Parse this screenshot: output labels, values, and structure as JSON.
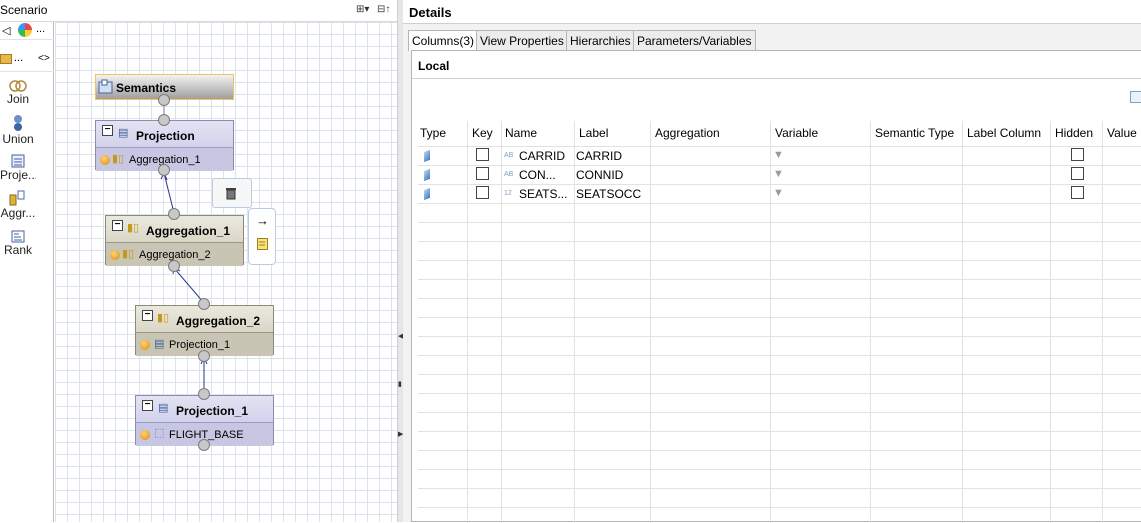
{
  "scenario": {
    "title": "Scenario",
    "toolbar": {
      "expand_label": "⊞▾",
      "collapse_label": "⊟↑"
    },
    "palette_top": {
      "back_label": "◁",
      "more_label": "...",
      "open_label": "...",
      "toggle_label": "<>"
    },
    "palette": [
      {
        "label": "Join",
        "icon": "join-icon"
      },
      {
        "label": "Union",
        "icon": "union-icon"
      },
      {
        "label": "Proje...",
        "icon": "projection-icon"
      },
      {
        "label": "Aggr...",
        "icon": "aggregation-icon"
      },
      {
        "label": "Rank",
        "icon": "rank-icon"
      }
    ]
  },
  "diagram": {
    "semantics": {
      "label": "Semantics"
    },
    "nodes": [
      {
        "title": "Projection",
        "input": "Aggregation_1",
        "kind": "projection"
      },
      {
        "title": "Aggregation_1",
        "input": "Aggregation_2",
        "kind": "aggregation"
      },
      {
        "title": "Aggregation_2",
        "input": "Projection_1",
        "kind": "aggregation"
      },
      {
        "title": "Projection_1",
        "input": "FLIGHT_BASE",
        "kind": "projection"
      }
    ],
    "actions": {
      "delete_icon": "trash-icon",
      "connect_icon": "arrow-right-icon",
      "note_icon": "note-icon"
    }
  },
  "details": {
    "title": "Details",
    "tabs": [
      {
        "label": "Columns(3)",
        "active": true
      },
      {
        "label": "View Properties",
        "active": false
      },
      {
        "label": "Hierarchies",
        "active": false
      },
      {
        "label": "Parameters/Variables",
        "active": false
      }
    ],
    "section": "Local",
    "columns": [
      "Type",
      "Key",
      "Name",
      "Label",
      "Aggregation",
      "Variable",
      "Semantic Type",
      "Label Column",
      "Hidden",
      "Value"
    ],
    "rows": [
      {
        "dtype": "AB",
        "name": "CARRID",
        "label": "CARRID",
        "key": false,
        "hidden": false
      },
      {
        "dtype": "AB",
        "name": "CON...",
        "label": "CONNID",
        "key": false,
        "hidden": false
      },
      {
        "dtype": "12",
        "name": "SEATS...",
        "label": "SEATSOCC",
        "key": false,
        "hidden": false
      }
    ]
  },
  "colors": {
    "projection_node": "#d2d2ec",
    "aggregation_node": "#dad7c8",
    "semantics_border": "#f1c35e",
    "grid_line": "#dde3ee"
  }
}
